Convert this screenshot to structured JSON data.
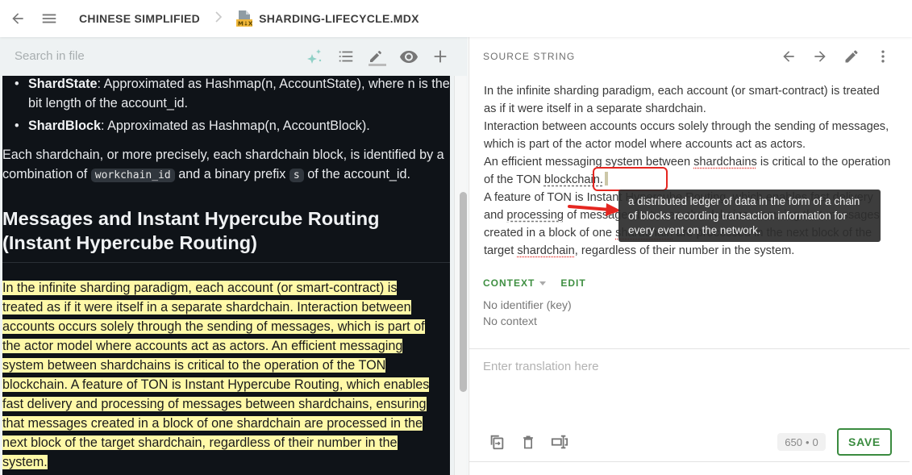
{
  "topbar": {
    "back_icon": "arrow-left-icon",
    "menu_icon": "hamburger-menu-icon",
    "breadcrumb": [
      "CHINESE SIMPLIFIED",
      "SHARDING-LIFECYCLE.MDX"
    ],
    "file_icon": "markdown-file-icon",
    "file_badge": "M↓X"
  },
  "left": {
    "search": {
      "placeholder": "Search in file",
      "value": ""
    },
    "tools": [
      "ai-sparkle-icon",
      "list-icon",
      "edit-pencil-icon",
      "eye-preview-icon",
      "plus-icon"
    ],
    "preview": {
      "bullets": [
        {
          "term": "ShardState",
          "text": ": Approximated as Hashmap(n, AccountState), where n is the bit length of the account_id."
        },
        {
          "term": "ShardBlock",
          "text": ": Approximated as Hashmap(n, AccountBlock)."
        }
      ],
      "para_parts": [
        "Each shardchain, or more precisely, each shardchain block, is identified by a combination of ",
        "workchain_id",
        " and a binary prefix ",
        "s",
        " of the account_id."
      ],
      "heading": "Messages and Instant Hypercube Routing (Instant Hypercube Routing)",
      "highlighted_lines": [
        "In the infinite sharding paradigm, each account (or smart-contract) is",
        "treated as if it were itself in a separate shardchain. Interaction between",
        "accounts occurs solely through the sending of messages, which is part of",
        "the actor model where accounts act as actors. An efficient messaging",
        "system between shardchains is critical to the operation of the TON",
        "blockchain. A feature of TON is Instant Hypercube Routing, which enables",
        "fast delivery and processing of messages between shardchains, ensuring",
        "that messages created in a block of one shardchain are processed in the",
        "next block of the target shardchain, regardless of their number in the",
        "system."
      ]
    }
  },
  "right": {
    "header": "SOURCE STRING",
    "tools": [
      "arrow-left-icon",
      "arrow-right-icon",
      "edit-pencil-icon",
      "more-vert-icon"
    ],
    "source": {
      "l1": "In the infinite sharding paradigm, each account (or smart-contract) is treated as if it were itself in a separate shardchain.",
      "l2": "Interaction between accounts occurs solely through the sending of messages, which is part of the actor model where accounts act as actors.",
      "l3a": "An efficient messaging system between ",
      "l3b": "shardchains",
      "l3c": " is critical to the operation of the TON ",
      "term": "blockchain.",
      "l4a": "A feature of TON is Instant Hypercube Routing, which enables fast delivery and ",
      "l4b": "processing",
      "l4c": " of messages between shardchains, ensuring that messages created in a block of one ",
      "l4d": "shardchain",
      "l4e": " are processed in the next block of the target ",
      "l4f": "shardchain",
      "l4g": ", regardless of their number in the system."
    },
    "tooltip": "a distributed ledger of data in the form of a chain of blocks recording transaction information for every event on the network.",
    "context": {
      "label": "CONTEXT",
      "edit": "EDIT",
      "identifier": "No identifier (key)",
      "context_text": "No context"
    },
    "translation": {
      "placeholder": "Enter translation here",
      "value": ""
    },
    "bottom_tools": [
      "copy-source-icon",
      "delete-icon",
      "cursor-insert-icon"
    ],
    "counter": {
      "source_chars": "650",
      "sep": "•",
      "translation_chars": "0"
    },
    "save_label": "SAVE",
    "accent": "#3a8b3f"
  }
}
